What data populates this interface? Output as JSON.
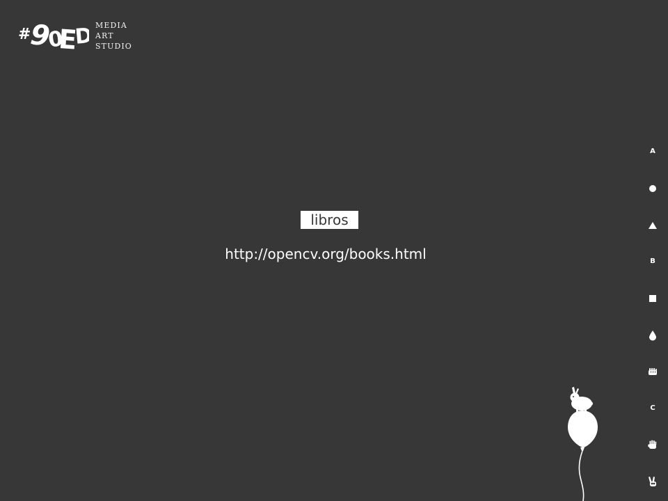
{
  "brand": {
    "logo_text": "#90ED",
    "tagline": [
      "MEDIA",
      "ART",
      "STUDIO"
    ]
  },
  "main": {
    "tag": "libros",
    "link": "http://opencv.org/books.html"
  },
  "side_nav": {
    "items": [
      {
        "type": "letter",
        "label": "A",
        "icon": "letter-a-icon"
      },
      {
        "type": "shape",
        "icon": "circle-icon"
      },
      {
        "type": "shape",
        "icon": "triangle-icon"
      },
      {
        "type": "letter",
        "label": "B",
        "icon": "letter-b-icon"
      },
      {
        "type": "shape",
        "icon": "square-icon"
      },
      {
        "type": "shape",
        "icon": "drop-icon"
      },
      {
        "type": "shape",
        "icon": "fist-icon"
      },
      {
        "type": "letter",
        "label": "C",
        "icon": "letter-c-icon"
      },
      {
        "type": "shape",
        "icon": "open-hand-icon"
      },
      {
        "type": "shape",
        "icon": "peace-hand-icon"
      }
    ]
  },
  "decoration": {
    "icon": "rabbit-on-balloon-icon"
  },
  "colors": {
    "background": "#373737",
    "foreground": "#ffffff"
  }
}
